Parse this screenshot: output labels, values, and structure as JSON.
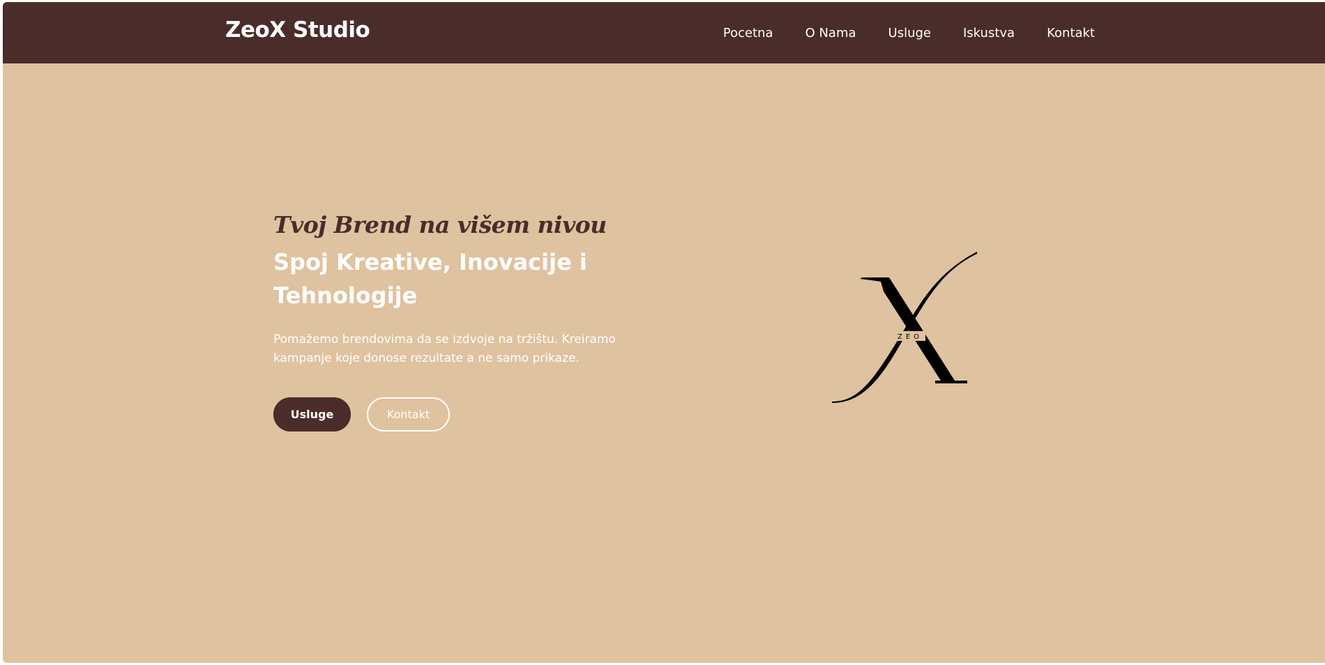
{
  "navbar": {
    "brand": "ZeoX Studio",
    "links": [
      "Pocetna",
      "O Nama",
      "Usluge",
      "Iskustva",
      "Kontakt"
    ]
  },
  "hero": {
    "tagline": "Tvoj Brend na višem nivou",
    "headline": "Spoj Kreative, Inovacije i Tehnologije",
    "description": "Pomažemo brendovima da se izdvoje na tržištu. Kreiramo kampanje koje donose rezultate a ne samo prikaze.",
    "buttons": {
      "primary": "Usluge",
      "secondary": "Kontakt"
    },
    "logo_text": "ZEO"
  },
  "colors": {
    "background": "#dfc29f",
    "navbar": "#4a2c2a",
    "text_light": "#ffffff",
    "accent_dark": "#4a2c2a"
  }
}
